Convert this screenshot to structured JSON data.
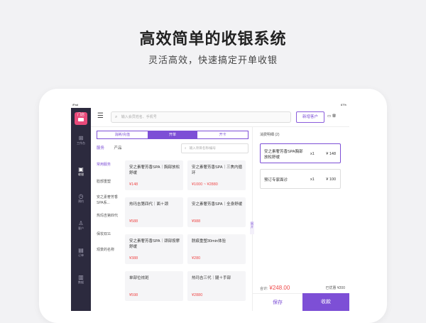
{
  "promo": {
    "title": "高效简单的收银系统",
    "subtitle": "灵活高效，快速搞定开单收银"
  },
  "status": {
    "carrier": "iPad",
    "battery": "67%"
  },
  "sidebar": {
    "logo_text": "门店",
    "items": [
      {
        "label": "工作台",
        "icon": "grid-icon"
      },
      {
        "label": "收银",
        "icon": "cashier-icon"
      },
      {
        "label": "预约",
        "icon": "clock-icon"
      },
      {
        "label": "客户",
        "icon": "user-icon"
      },
      {
        "label": "订单",
        "icon": "document-icon"
      },
      {
        "label": "数据",
        "icon": "chart-icon"
      }
    ]
  },
  "topbar": {
    "search_placeholder": "输入会员姓名、手机号",
    "add_customer": "新增客户",
    "orders": "单"
  },
  "mode_tabs": [
    {
      "label": "消耗/充值"
    },
    {
      "label": "开单"
    },
    {
      "label": "开卡"
    }
  ],
  "item_tabs": [
    {
      "label": "服务"
    },
    {
      "label": "产品"
    }
  ],
  "item_search_placeholder": "输入项目名称/编号",
  "categories": [
    "常用服务",
    "脸部重塑",
    "安之素奢芳香SPA系...",
    "热玛吉第四代",
    "保妆双11",
    "观景的名称"
  ],
  "products": [
    {
      "name": "安之素奢芳香SPA｜胸部放松舒缓",
      "price": "¥148"
    },
    {
      "name": "安之素奢芳香SPA｜三焦内循环",
      "price": "¥1000 ~ ¥2880"
    },
    {
      "name": "热玛吉第四代｜面＋颈",
      "price": "¥588"
    },
    {
      "name": "安之素奢芳香SPA｜全身舒缓",
      "price": "¥988"
    },
    {
      "name": "安之素奢芳香SPA｜颈部按摩舒缓",
      "price": "¥388"
    },
    {
      "name": "脱痕重塑30min体验",
      "price": "¥280"
    },
    {
      "name": "单部位祛斑",
      "price": "¥598"
    },
    {
      "name": "热玛吉三代｜腿＋手部",
      "price": "¥2880"
    }
  ],
  "detail": {
    "title": "消费明细 (2)",
    "items": [
      {
        "name": "安之素奢芳香SPA胸部放松舒缓",
        "qty": "x1",
        "price": "¥ 148"
      },
      {
        "name": "预订专家面诊",
        "qty": "x1",
        "price": "¥ 100"
      }
    ],
    "total_label": "合计:",
    "total": "¥248.00",
    "discount": "已优惠 ¥200"
  },
  "actions": {
    "save": "保存",
    "pay": "收款"
  },
  "collapse_label": "展开"
}
